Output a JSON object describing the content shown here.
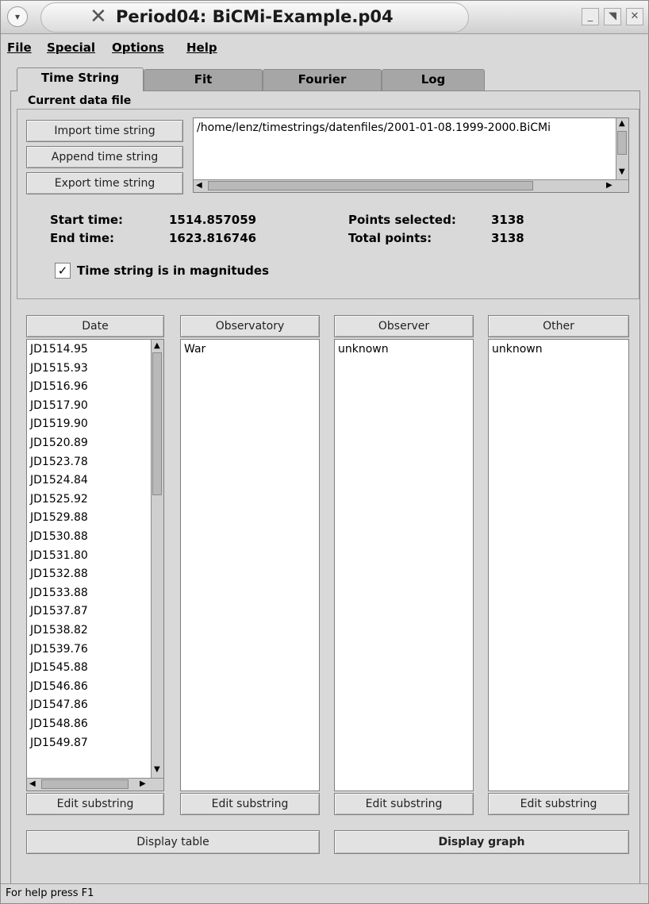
{
  "window": {
    "title": "Period04: BiCMi-Example.p04",
    "menu_icon": "menu-circle-icon",
    "controls": [
      "minimize-icon",
      "maximize-icon",
      "close-icon"
    ]
  },
  "menubar": [
    {
      "label": "File"
    },
    {
      "label": "Special"
    },
    {
      "label": "Options"
    },
    {
      "label": "Help"
    }
  ],
  "tabs": [
    {
      "label": "Time String",
      "active": true
    },
    {
      "label": "Fit",
      "active": false
    },
    {
      "label": "Fourier",
      "active": false
    },
    {
      "label": "Log",
      "active": false
    }
  ],
  "current_data_file": {
    "group_label": "Current data file",
    "import_label": "Import time string",
    "append_label": "Append time string",
    "export_label": "Export time string",
    "path": "/home/lenz/timestrings/datenfiles/2001-01-08.1999-2000.BiCMi"
  },
  "stats": {
    "start_time_label": "Start time:",
    "start_time_value": "1514.857059",
    "end_time_label": "End time:",
    "end_time_value": "1623.816746",
    "points_selected_label": "Points selected:",
    "points_selected_value": "3138",
    "total_points_label": "Total points:",
    "total_points_value": "3138"
  },
  "magnitudes": {
    "label": "Time string is in magnitudes",
    "checked": true
  },
  "columns": [
    {
      "header": "Date",
      "items": [
        "JD1514.95",
        "JD1515.93",
        "JD1516.96",
        "JD1517.90",
        "JD1519.90",
        "JD1520.89",
        "JD1523.78",
        "JD1524.84",
        "JD1525.92",
        "JD1529.88",
        "JD1530.88",
        "JD1531.80",
        "JD1532.88",
        "JD1533.88",
        "JD1537.87",
        "JD1538.82",
        "JD1539.76",
        "JD1545.88",
        "JD1546.86",
        "JD1547.86",
        "JD1548.86",
        "JD1549.87"
      ],
      "edit_label": "Edit substring"
    },
    {
      "header": "Observatory",
      "items": [
        "War"
      ],
      "edit_label": "Edit substring"
    },
    {
      "header": "Observer",
      "items": [
        "unknown"
      ],
      "edit_label": "Edit substring"
    },
    {
      "header": "Other",
      "items": [
        "unknown"
      ],
      "edit_label": "Edit substring"
    }
  ],
  "buttons": {
    "display_table": "Display table",
    "display_graph": "Display graph"
  },
  "status": {
    "text": "For help press F1"
  }
}
